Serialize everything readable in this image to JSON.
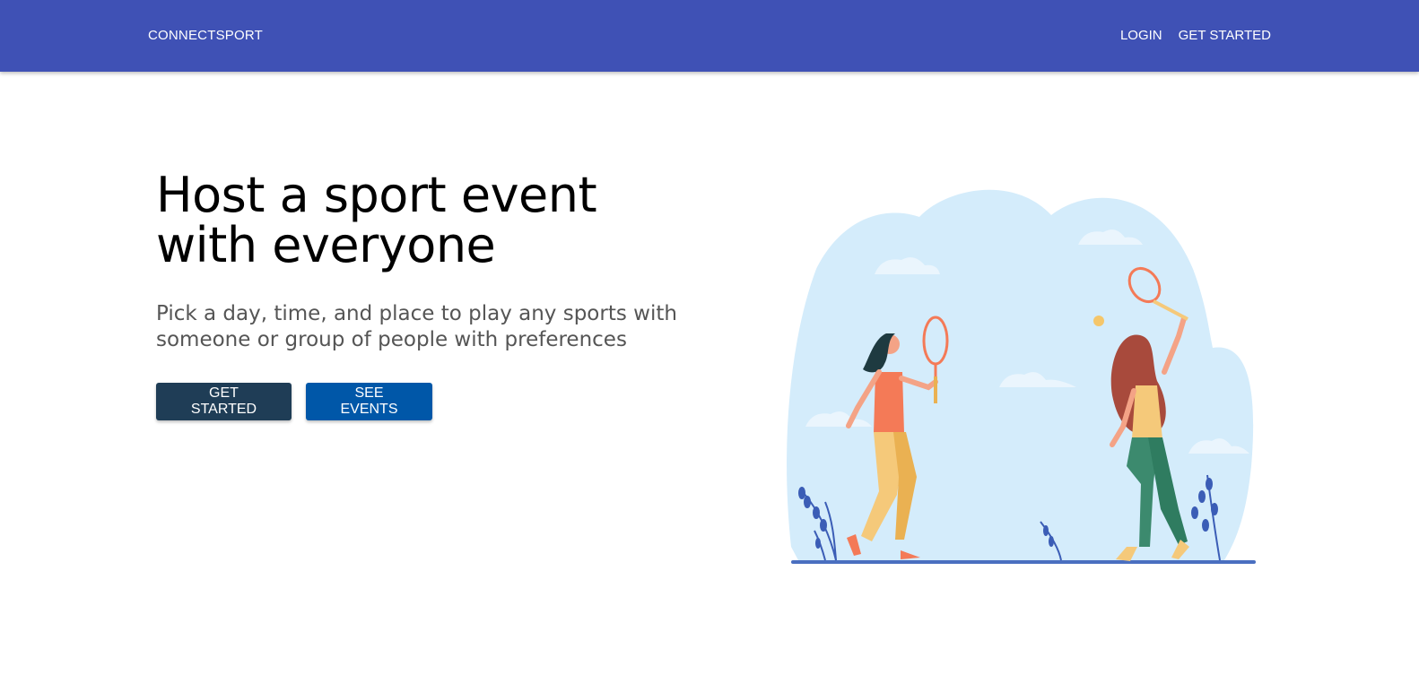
{
  "header": {
    "brand": "CONNECTSPORT",
    "nav": {
      "login": "LOGIN",
      "get_started": "GET STARTED"
    },
    "color": "#3f51b5"
  },
  "hero": {
    "title": "Host a sport event with everyone",
    "subtitle": "Pick a day, time, and place to play any sports with someone or group of people with preferences",
    "buttons": {
      "get_started": "GET STARTED",
      "see_events": "SEE EVENTS"
    },
    "colors": {
      "get_started_bg": "#1f3d56",
      "see_events_bg": "#0057a8"
    }
  },
  "illustration": {
    "subject": "two-women-playing-tennis-illustration"
  }
}
